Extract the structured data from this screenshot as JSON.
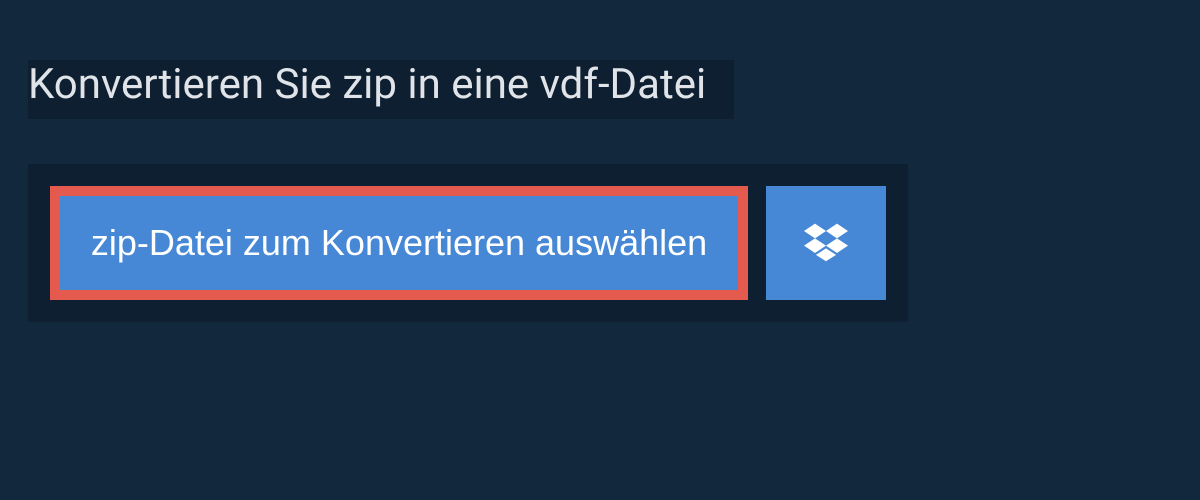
{
  "header": {
    "title": "Konvertieren Sie zip in eine vdf-Datei"
  },
  "actions": {
    "select_file_label": "zip-Datei zum Konvertieren auswählen",
    "dropbox_icon": "dropbox-icon"
  },
  "colors": {
    "background": "#11283d",
    "panel": "#0d1f30",
    "button": "#4688d6",
    "highlight_border": "#e55a4f",
    "text_light": "#e0e4e8"
  }
}
